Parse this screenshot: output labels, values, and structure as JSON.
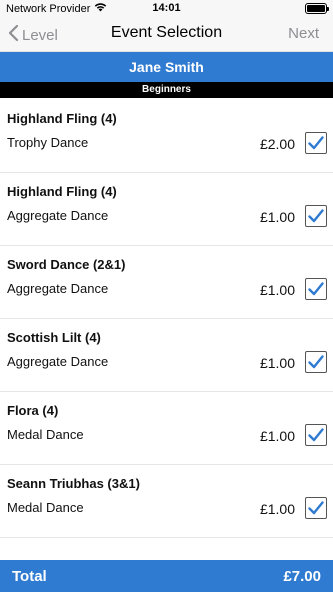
{
  "status_bar": {
    "carrier": "Network Provider",
    "time": "14:01",
    "icons": [
      "wifi-icon",
      "battery-icon"
    ]
  },
  "nav": {
    "back_label": "Level",
    "title": "Event Selection",
    "next_label": "Next"
  },
  "dancer_name": "Jane Smith",
  "level": "Beginners",
  "events": [
    {
      "name": "Highland Fling (4)",
      "type": "Trophy Dance",
      "price": "£2.00",
      "checked": true
    },
    {
      "name": "Highland Fling (4)",
      "type": "Aggregate Dance",
      "price": "£1.00",
      "checked": true
    },
    {
      "name": "Sword Dance (2&1)",
      "type": "Aggregate Dance",
      "price": "£1.00",
      "checked": true
    },
    {
      "name": "Scottish Lilt (4)",
      "type": "Aggregate Dance",
      "price": "£1.00",
      "checked": true
    },
    {
      "name": "Flora (4)",
      "type": "Medal Dance",
      "price": "£1.00",
      "checked": true
    },
    {
      "name": "Seann Triubhas (3&1)",
      "type": "Medal Dance",
      "price": "£1.00",
      "checked": true
    }
  ],
  "total": {
    "label": "Total",
    "value": "£7.00"
  },
  "colors": {
    "accent": "#2f7bd1",
    "level_bar": "#000000",
    "checkmark": "#2f7bd1"
  }
}
